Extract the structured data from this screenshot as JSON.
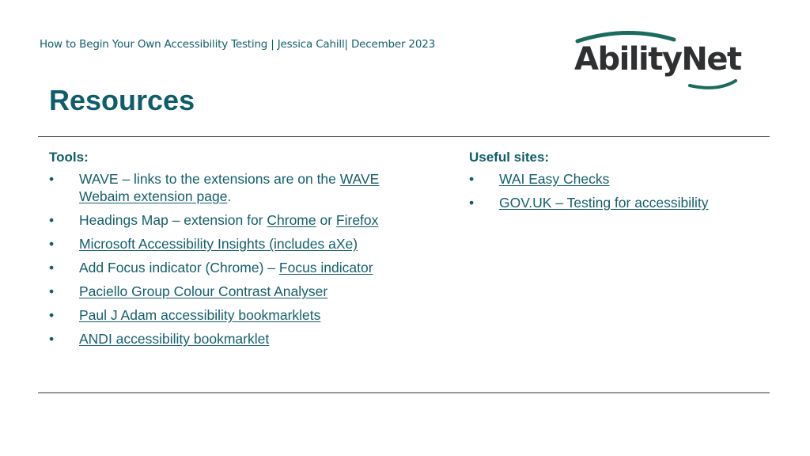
{
  "header": {
    "subtitle": "How to Begin Your Own Accessibility Testing | Jessica Cahill| December 2023",
    "logo_text": "AbilityNet"
  },
  "title": "Resources",
  "colors": {
    "accent": "#0f5d6b",
    "logo_text": "#2f3032",
    "logo_swoosh": "#1a6b5e"
  },
  "tools": {
    "heading": "Tools:",
    "bullet": "•",
    "items": [
      {
        "text_before": "WAVE – links to the extensions are on the ",
        "link": "WAVE Webaim extension page",
        "text_after": "."
      },
      {
        "text_before": "Headings Map – extension for ",
        "link": "Chrome",
        "middle": " or ",
        "link2": "Firefox"
      },
      {
        "link": "Microsoft Accessibility Insights (includes aXe)"
      },
      {
        "text_before": "Add Focus indicator (Chrome) – ",
        "link": "Focus indicator"
      },
      {
        "link": "Paciello Group Colour Contrast Analyser"
      },
      {
        "link": "Paul J Adam accessibility bookmarklets"
      },
      {
        "link": "ANDI accessibility bookmarklet"
      }
    ]
  },
  "useful_sites": {
    "heading": "Useful sites:",
    "bullet": "•",
    "items": [
      {
        "link": "WAI Easy Checks"
      },
      {
        "link": "GOV.UK – Testing for accessibility"
      }
    ]
  }
}
